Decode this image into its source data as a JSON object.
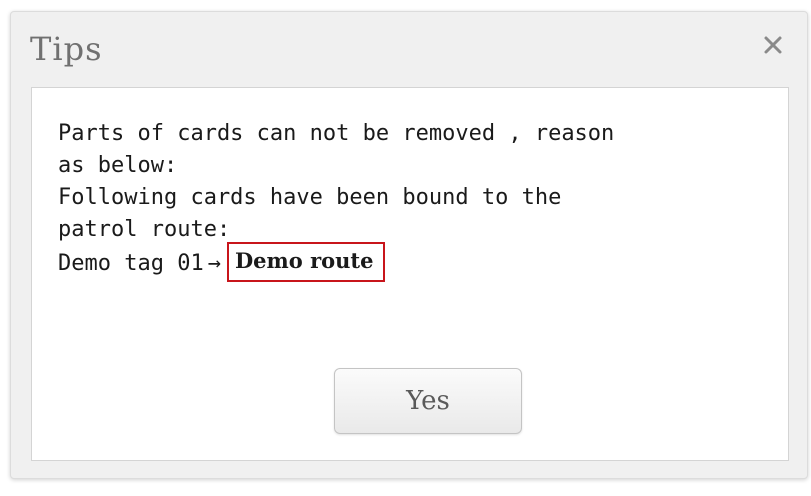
{
  "dialog": {
    "title": "Tips",
    "close_icon": "close-icon",
    "message": {
      "line1": "Parts of cards can not be removed , reason",
      "line2": "as below:",
      "line3": "Following cards have been bound to the",
      "line4": "patrol route:",
      "card_name": "Demo tag 01",
      "arrow": "→",
      "route_name": "Demo route"
    },
    "confirm_label": "Yes"
  },
  "colors": {
    "dialog_background": "#f0f0f0",
    "highlight_border": "#c8151b",
    "title_text": "#707070"
  }
}
